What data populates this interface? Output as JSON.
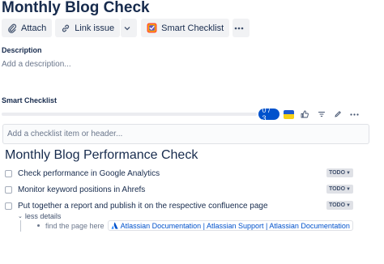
{
  "page": {
    "title": "Monthly Blog Check"
  },
  "toolbar": {
    "attach_label": "Attach",
    "link_issue_label": "Link issue",
    "smart_checklist_label": "Smart Checklist",
    "more_label": "•••"
  },
  "description": {
    "label": "Description",
    "placeholder": "Add a description..."
  },
  "smart_checklist": {
    "label": "Smart Checklist",
    "progress": {
      "text": "0 / 3",
      "completed": 0,
      "total": 3
    },
    "add_placeholder": "Add a checklist item or header...",
    "checklist_title": "Monthly Blog Performance Check",
    "items": [
      {
        "text": "Check performance in Google Analytics",
        "status": "TODO",
        "checked": false
      },
      {
        "text": "Monitor keyword positions in Ahrefs",
        "status": "TODO",
        "checked": false
      },
      {
        "text": "Put together a report and publish it on the respective confluence page",
        "status": "TODO",
        "checked": false
      }
    ],
    "details_toggle": "less details",
    "detail_note": "find the page here",
    "detail_link": "Atlassian Documentation | Atlassian Support | Atlassian Documentation"
  },
  "icons": {
    "attach": "paperclip-icon",
    "link": "link-icon",
    "smart_checklist": "smart-checklist-logo-icon",
    "flag": "ukraine-flag-icon",
    "like": "thumbs-up-icon",
    "filter": "filter-icon",
    "edit": "pencil-icon",
    "more": "more-icon",
    "atlassian": "atlassian-logo-icon"
  },
  "colors": {
    "primary_text": "#172b4d",
    "muted_text": "#6b778c",
    "badge_blue": "#0052cc",
    "link_blue": "#0052cc",
    "flag_blue": "#1d5ad0",
    "flag_yellow": "#f7d117",
    "status_bg": "#dfe1e6"
  }
}
